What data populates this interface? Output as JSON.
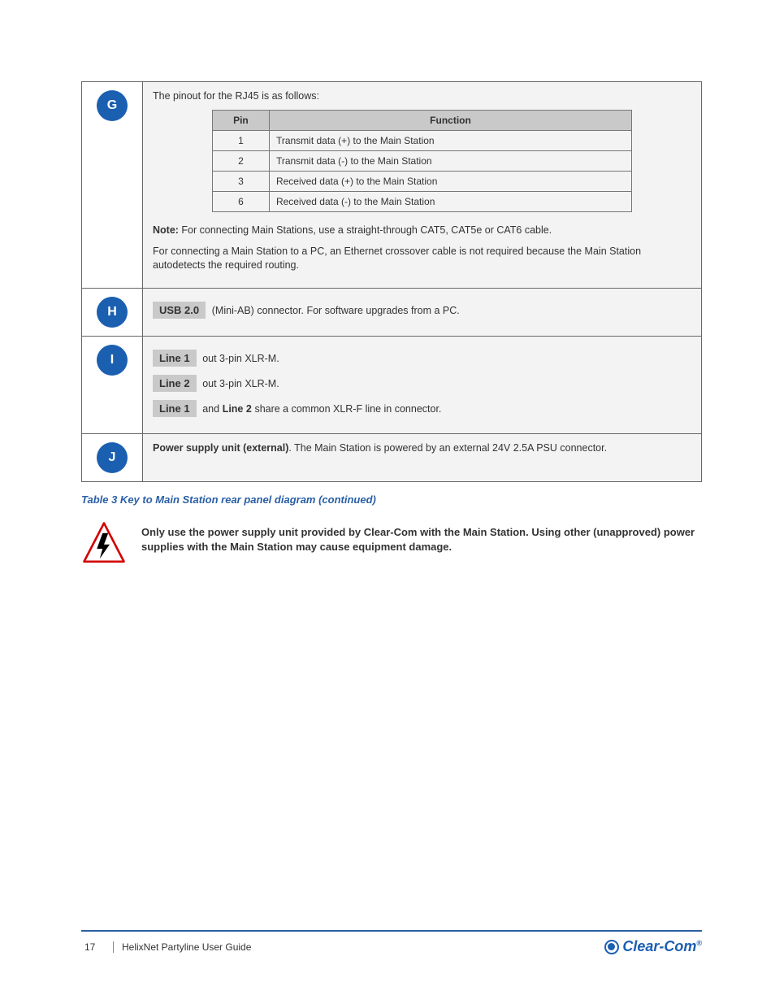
{
  "rows": {
    "r1": {
      "marker": "G",
      "intro": "The pinout for the RJ45 is as follows:",
      "table": {
        "h1": "Pin",
        "h2": "Function",
        "p1": {
          "pin": "1",
          "fn": "Transmit data (+) to the Main Station"
        },
        "p2": {
          "pin": "2",
          "fn": "Transmit data (-) to the Main Station"
        },
        "p3": {
          "pin": "3",
          "fn": "Received data (+) to the Main Station"
        },
        "p4": {
          "pin": "6",
          "fn": "Received data (-) to the Main Station"
        }
      },
      "notes": {
        "n1_pre": "Note:",
        "n1": " For connecting Main Stations, use a straight-through CAT5, CAT5e or CAT6 cable.",
        "n2": "For connecting a Main Station to a PC, an Ethernet crossover cable is not required because the Main Station autodetects the required routing."
      }
    },
    "r2": {
      "marker": "H",
      "label": "USB 2.0",
      "text": " (Mini-AB) connector. For software upgrades from a PC."
    },
    "r3": {
      "marker": "I",
      "l1": "Line 1",
      "t1": " out 3-pin XLR-M.",
      "l2": "Line 2",
      "t2": " out 3-pin XLR-M.",
      "l3": "Line 1",
      "t3": " and",
      "l3b": " Line 2",
      "t3b": " share a common XLR-F line in connector."
    },
    "r4": {
      "marker": "J",
      "title": "Power supply unit (external)",
      "text": ". The Main Station is powered by an external 24V 2.5A PSU connector."
    }
  },
  "caption": "Table 3 Key to Main Station rear panel diagram (continued)",
  "warning": "Only use the power supply unit provided by Clear-Com with the Main Station. Using other (unapproved) power supplies with the Main Station may cause equipment damage.",
  "footer": {
    "page": "17",
    "title": "HelixNet Partyline User Guide",
    "brand": "Clear-Com"
  }
}
